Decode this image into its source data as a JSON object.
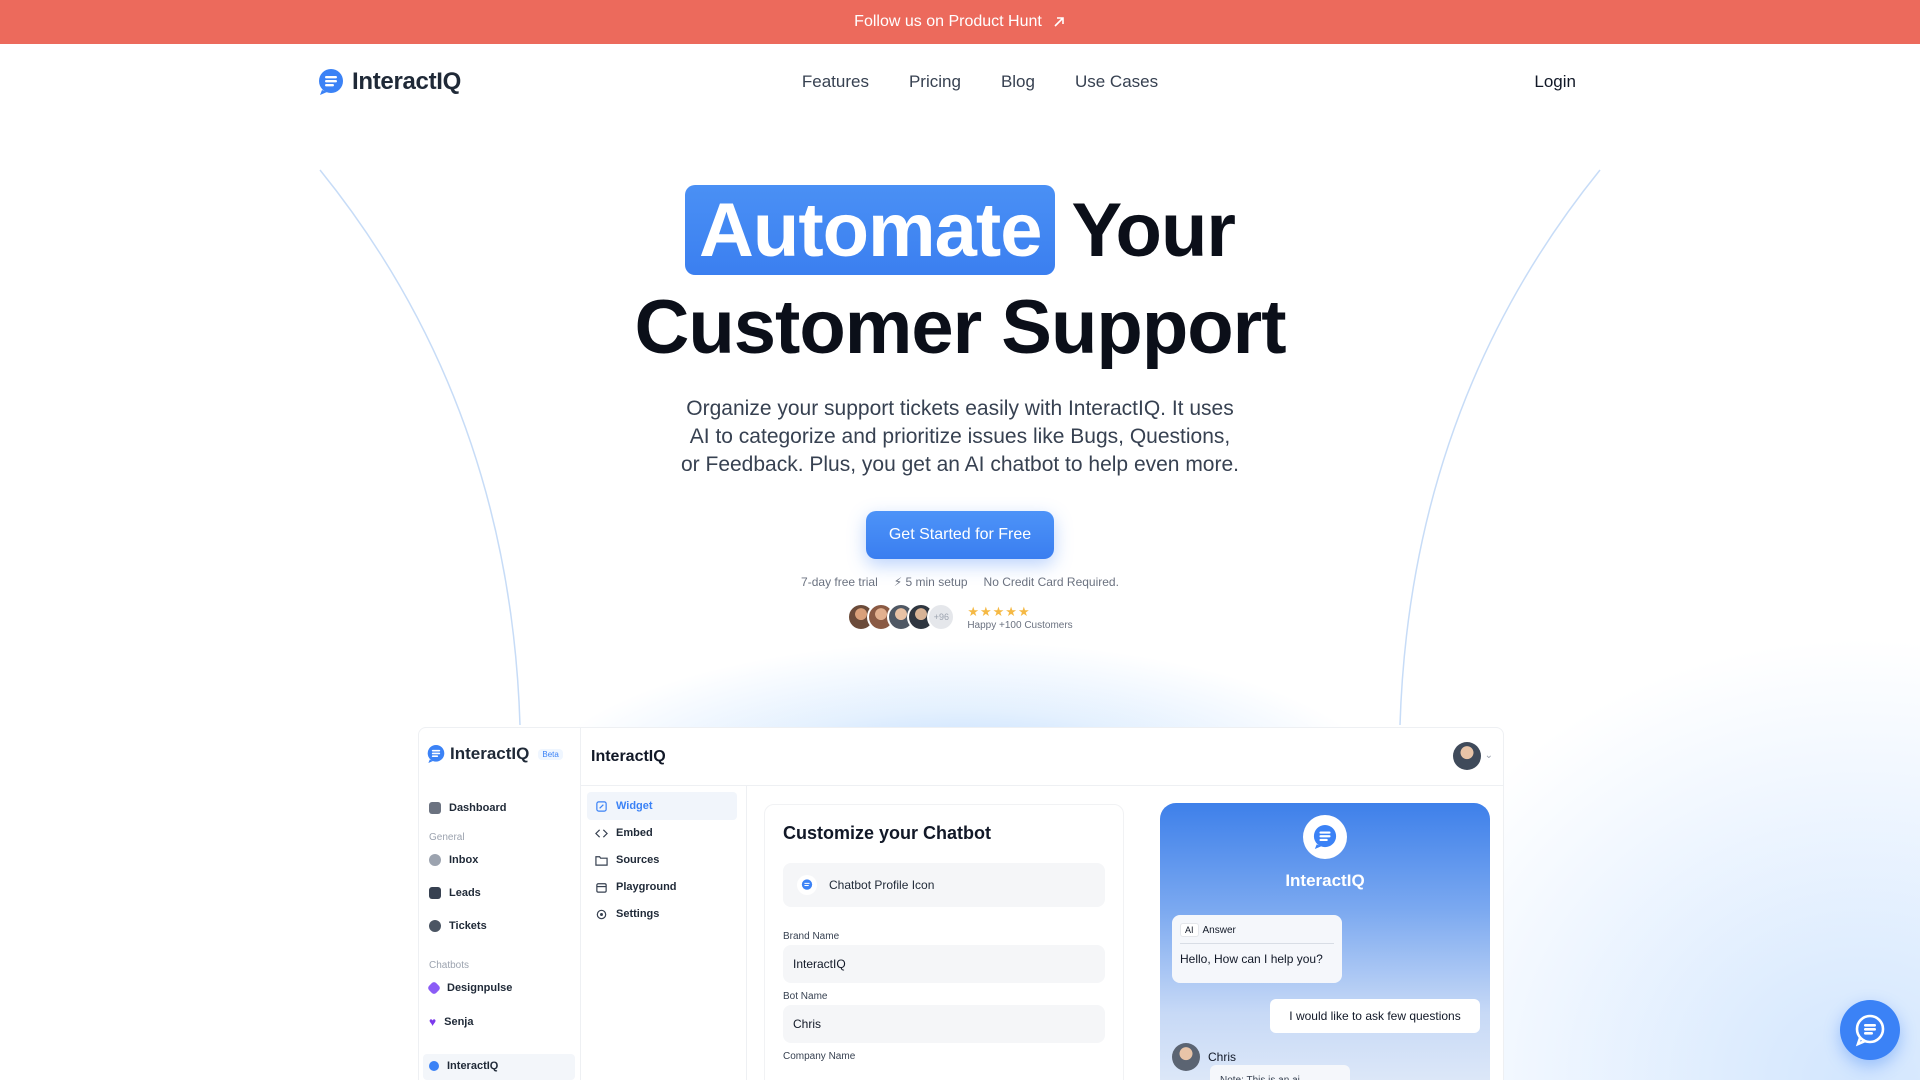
{
  "promo": {
    "text": "Follow us on Product Hunt"
  },
  "header": {
    "brand": "InteractIQ",
    "nav": [
      "Features",
      "Pricing",
      "Blog",
      "Use Cases"
    ],
    "login": "Login"
  },
  "hero": {
    "highlight": "Automate",
    "word": "Your",
    "line2": "Customer Support",
    "description": "Organize your support tickets easily with InteractIQ. It uses AI to categorize and prioritize issues like Bugs, Questions, or Feedback. Plus, you get an AI chatbot to help even more.",
    "cta": "Get Started for Free",
    "features": [
      "7-day free trial",
      "⚡ 5 min setup",
      "No Credit Card Required."
    ],
    "avatar_extra": "+96",
    "stars": "★★★★★",
    "rating_text": "Happy +100 Customers"
  },
  "app": {
    "brand": "InteractIQ",
    "beta": "Beta",
    "title": "InteractIQ",
    "sidebar": {
      "dashboard": "Dashboard",
      "general_label": "General",
      "inbox": "Inbox",
      "leads": "Leads",
      "tickets": "Tickets",
      "chatbots_label": "Chatbots",
      "bot1": "Designpulse",
      "bot2": "Senja",
      "bot3": "InteractIQ"
    },
    "menu": [
      "Widget",
      "Embed",
      "Sources",
      "Playground",
      "Settings"
    ],
    "form": {
      "title": "Customize your Chatbot",
      "profile_icon": "Chatbot Profile Icon",
      "brand_label": "Brand Name",
      "brand_value": "InteractIQ",
      "bot_label": "Bot Name",
      "bot_value": "Chris",
      "company_label": "Company Name"
    },
    "chat": {
      "brand": "InteractIQ",
      "ai_tag": "AI",
      "ai_head": "Answer",
      "ai_text": "Hello, How can I help you?",
      "user_text": "I would like to ask few questions",
      "agent": "Chris",
      "agent_text": "Note: This is an ai..."
    }
  },
  "colors": {
    "promo": "#ec6a5c",
    "accent": "#3b82f6",
    "heading": "#0b0f19"
  }
}
